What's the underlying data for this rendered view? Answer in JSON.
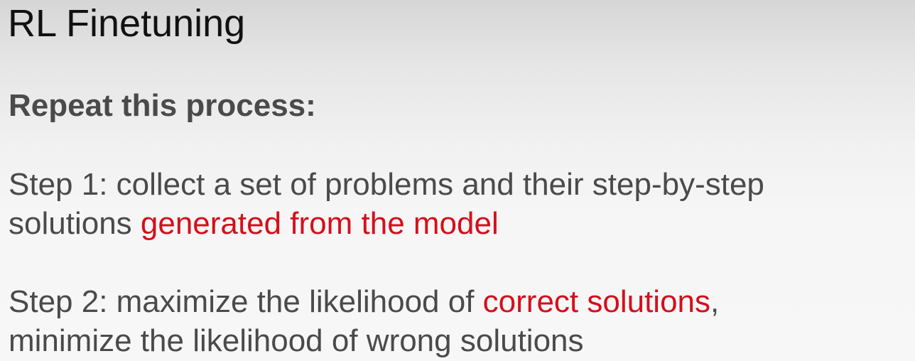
{
  "slide": {
    "title": "RL Finetuning",
    "heading": "Repeat this process:",
    "step1": {
      "line1": "Step 1: collect a set of problems and their step-by-step",
      "line2_prefix": "solutions ",
      "line2_highlight": "generated from the model"
    },
    "step2": {
      "line1_prefix": "Step 2: maximize the likelihood of ",
      "line1_highlight": "correct solutions",
      "line1_suffix": ",",
      "line2": "minimize the likelihood of wrong solutions"
    },
    "colors": {
      "highlight": "#d40f1b",
      "body_text": "#4a4a4a",
      "title_text": "#111111"
    }
  }
}
